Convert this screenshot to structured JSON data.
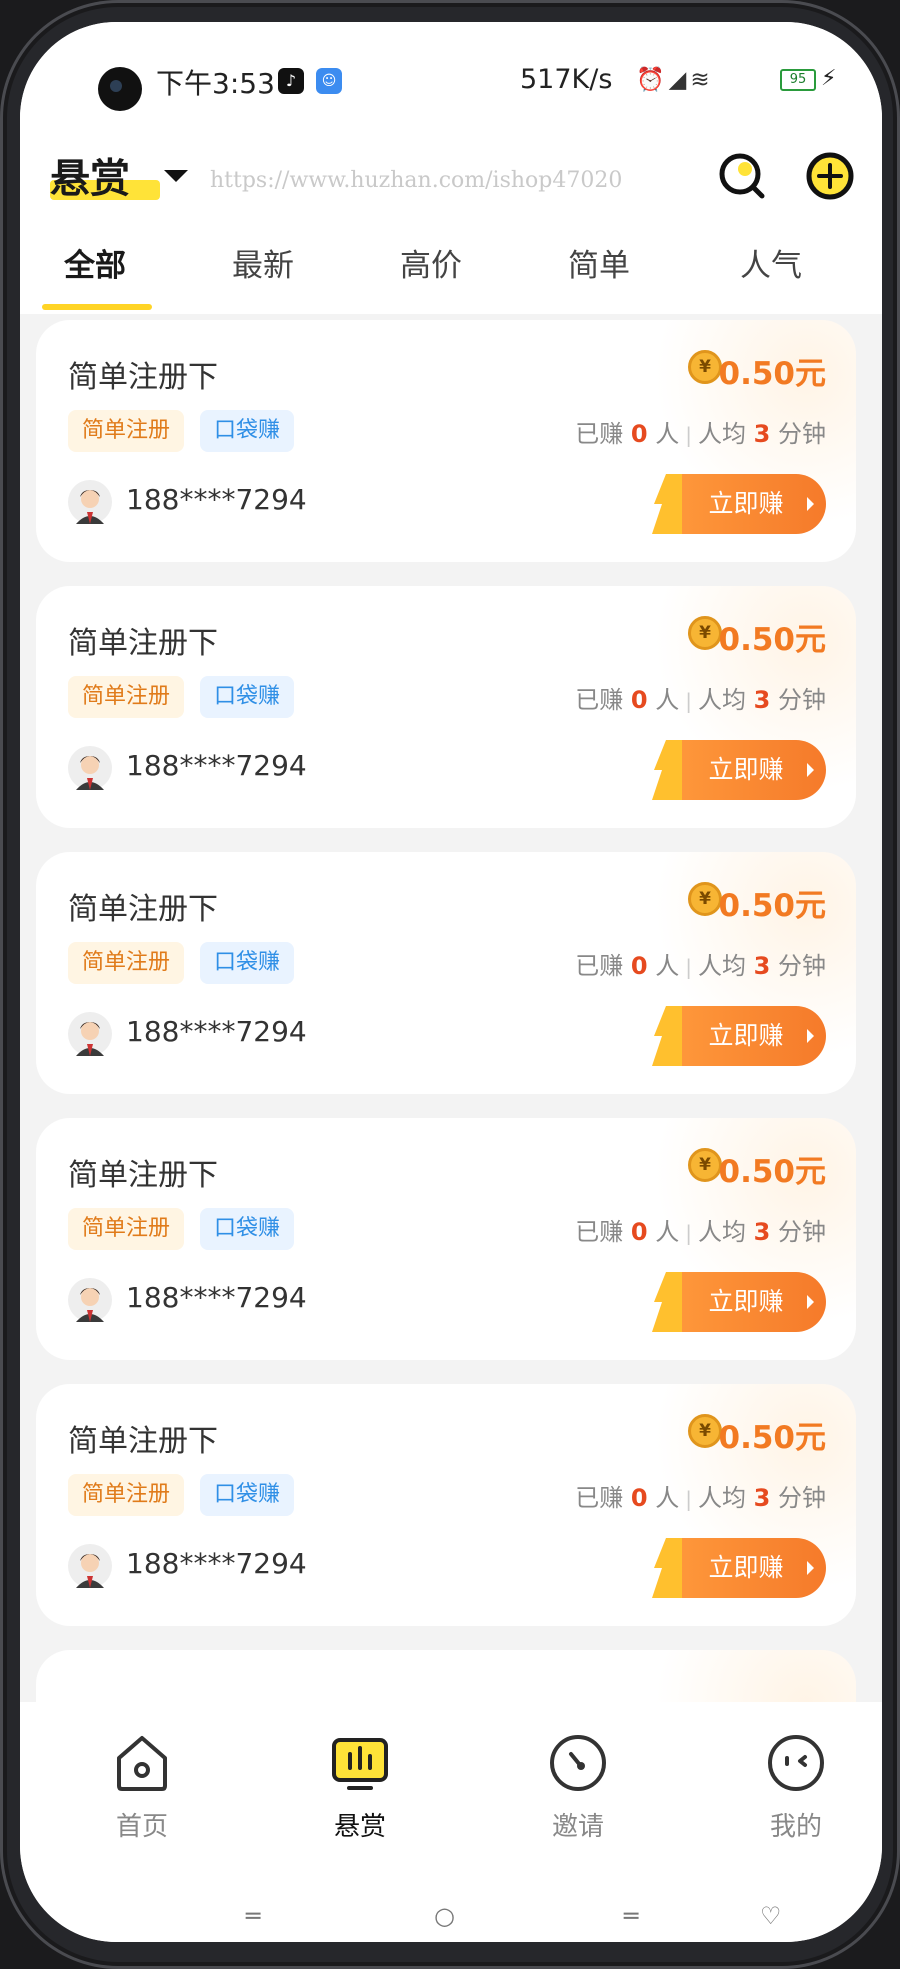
{
  "status_bar": {
    "time": "下午3:53",
    "net_speed": "517K/s",
    "battery": "95",
    "icons": [
      "tiktok-icon",
      "app-icon",
      "alarm-icon",
      "signal-icon",
      "wifi-icon",
      "battery-icon",
      "charging-icon"
    ]
  },
  "header": {
    "title": "悬赏",
    "watermark": "https://www.huzhan.com/ishop47020",
    "accent_color": "#ffe338"
  },
  "tabs": [
    {
      "label": "全部",
      "active": true
    },
    {
      "label": "最新",
      "active": false
    },
    {
      "label": "高价",
      "active": false
    },
    {
      "label": "简单",
      "active": false
    },
    {
      "label": "人气",
      "active": false
    }
  ],
  "cards": [
    {
      "title": "简单注册下",
      "tag1": "简单注册",
      "tag2": "口袋赚",
      "reward": "0.50元",
      "stat_earned_label": "已赚",
      "stat_earned": "0",
      "stat_unit": "人",
      "stat_avg_label": "人均",
      "stat_avg": "3",
      "stat_time_unit": "分钟",
      "user": "188****7294",
      "button": "立即赚"
    },
    {
      "title": "简单注册下",
      "tag1": "简单注册",
      "tag2": "口袋赚",
      "reward": "0.50元",
      "stat_earned_label": "已赚",
      "stat_earned": "0",
      "stat_unit": "人",
      "stat_avg_label": "人均",
      "stat_avg": "3",
      "stat_time_unit": "分钟",
      "user": "188****7294",
      "button": "立即赚"
    },
    {
      "title": "简单注册下",
      "tag1": "简单注册",
      "tag2": "口袋赚",
      "reward": "0.50元",
      "stat_earned_label": "已赚",
      "stat_earned": "0",
      "stat_unit": "人",
      "stat_avg_label": "人均",
      "stat_avg": "3",
      "stat_time_unit": "分钟",
      "user": "188****7294",
      "button": "立即赚"
    },
    {
      "title": "简单注册下",
      "tag1": "简单注册",
      "tag2": "口袋赚",
      "reward": "0.50元",
      "stat_earned_label": "已赚",
      "stat_earned": "0",
      "stat_unit": "人",
      "stat_avg_label": "人均",
      "stat_avg": "3",
      "stat_time_unit": "分钟",
      "user": "188****7294",
      "button": "立即赚"
    },
    {
      "title": "简单注册下",
      "tag1": "简单注册",
      "tag2": "口袋赚",
      "reward": "0.50元",
      "stat_earned_label": "已赚",
      "stat_earned": "0",
      "stat_unit": "人",
      "stat_avg_label": "人均",
      "stat_avg": "3",
      "stat_time_unit": "分钟",
      "user": "188****7294",
      "button": "立即赚"
    }
  ],
  "coin_symbol": "¥",
  "bottom_nav": [
    {
      "label": "首页",
      "icon": "home-icon",
      "active": false
    },
    {
      "label": "悬赏",
      "icon": "bounty-icon",
      "active": true
    },
    {
      "label": "邀请",
      "icon": "invite-icon",
      "active": false
    },
    {
      "label": "我的",
      "icon": "profile-icon",
      "active": false
    }
  ],
  "colors": {
    "reward": "#f27a22",
    "button": "#f57a2a",
    "tag_orange": "#e07b1a",
    "tag_blue": "#2f8fe6",
    "stat_number": "#e64a1f"
  }
}
